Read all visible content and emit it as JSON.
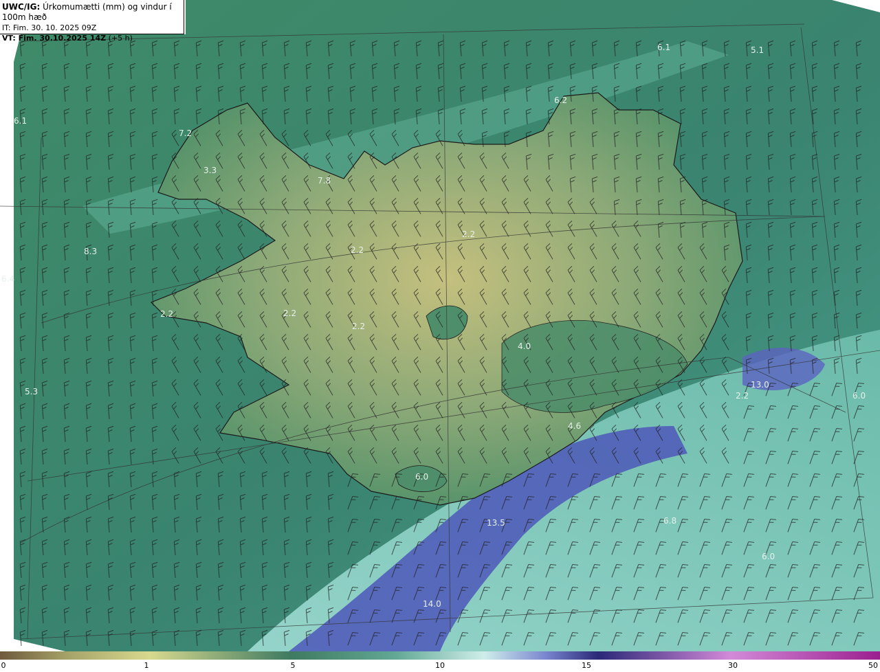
{
  "header": {
    "model": "UWC/IG:",
    "title": "Úrkomumætti (mm) og vindur í 100m hæð",
    "issue_time": "IT: Fim. 30. 10. 2025 09Z",
    "valid_prefix": "VT: Fim. 30.10.2025 14Z",
    "valid_lead": "(+5 h)"
  },
  "colorbar": {
    "ticks": [
      "0",
      "1",
      "5",
      "10",
      "15",
      "30",
      "50"
    ],
    "colors": [
      "#6f5a3c",
      "#a8a56a",
      "#d8d98e",
      "#3f7a61",
      "#62a894",
      "#cfeeea",
      "#7a86cf",
      "#2a2878",
      "#d28ad8",
      "#9b1f8f"
    ]
  },
  "map_labels": [
    "6.1",
    "7.2",
    "3.3",
    "7.8",
    "8.3",
    "6.4",
    "2.2",
    "2.2",
    "2.2",
    "2.2",
    "2.2",
    "2.2",
    "5.3",
    "4.0",
    "4.6",
    "6.0",
    "13.5",
    "14.0",
    "13.0",
    "5.1",
    "6.1",
    "6.2",
    "6.0",
    "6.8",
    "6.0"
  ],
  "colors": {
    "ocean": "#3b8a6e",
    "land_low": "#4f8f65",
    "land_high": "#c9c483",
    "precip_light": "#a8e3dc",
    "precip_heavy": "#4b4fb3",
    "coast": "#1a1a1a",
    "grid": "#333333"
  }
}
